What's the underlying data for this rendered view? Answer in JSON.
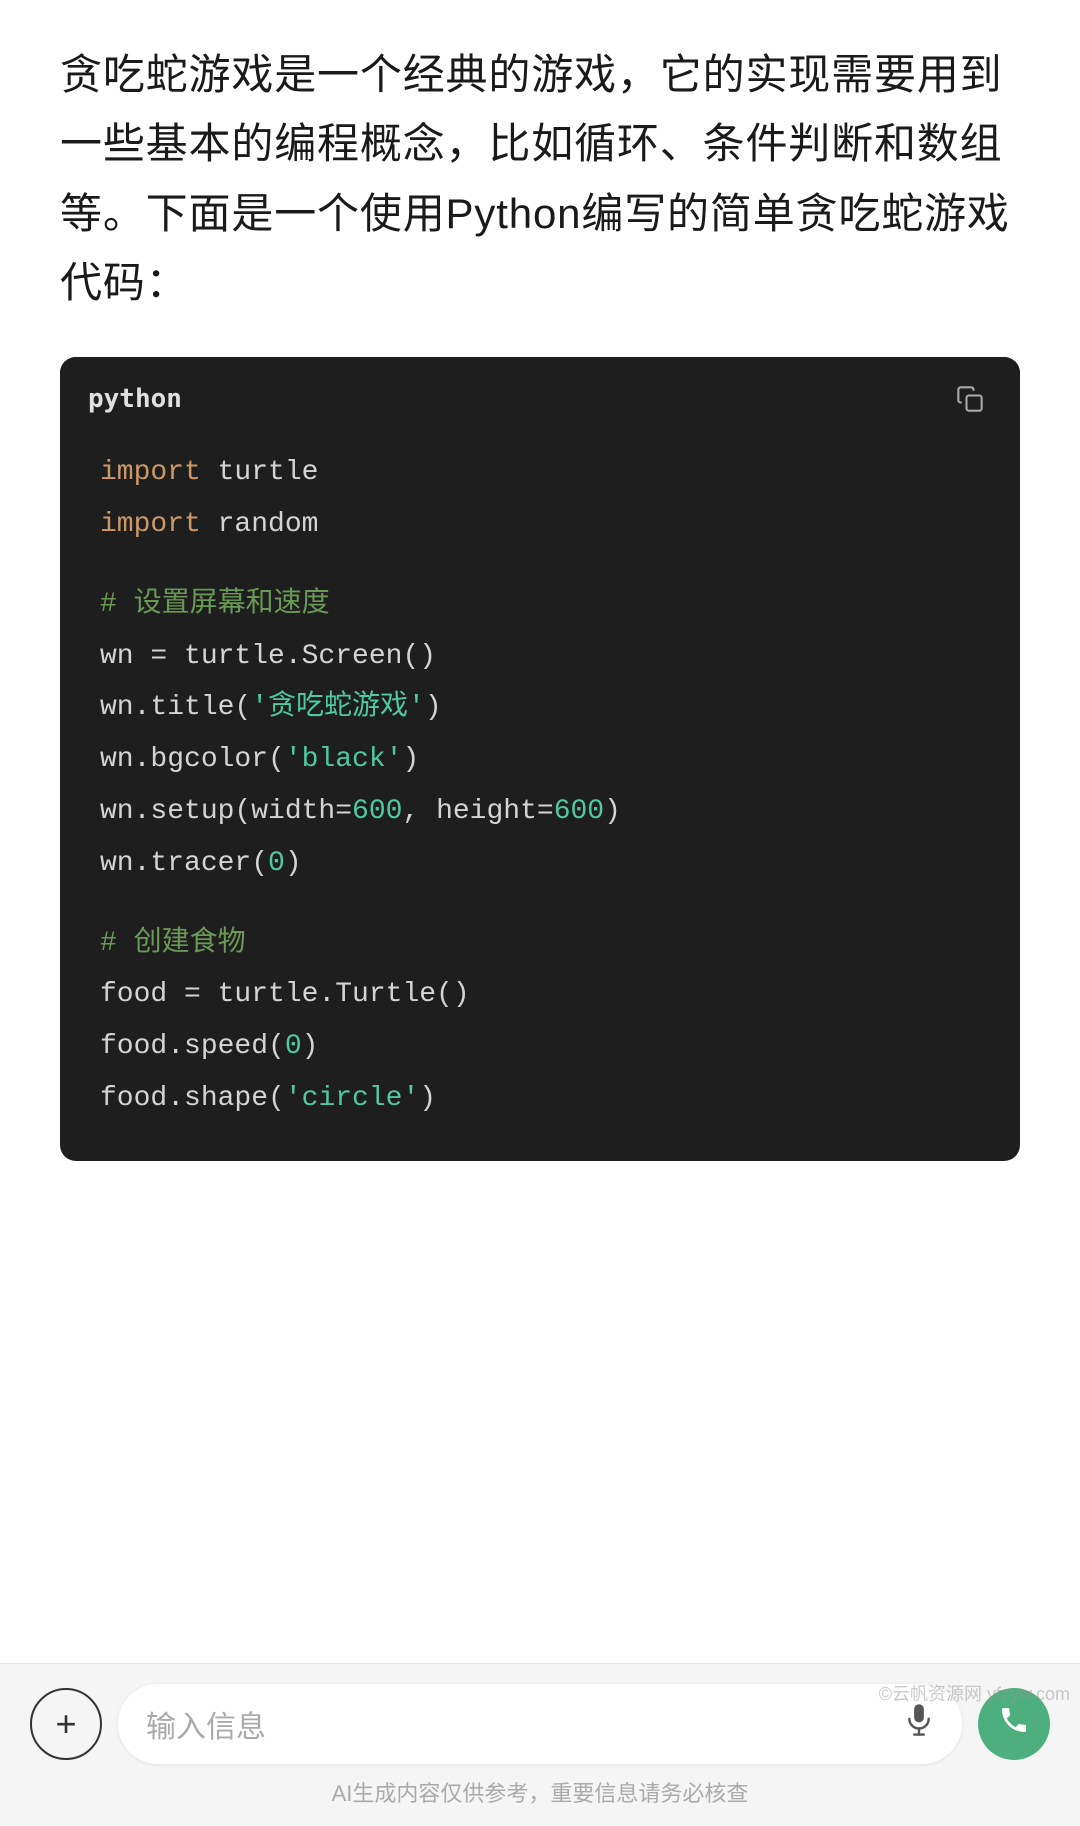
{
  "description": {
    "text": "贪吃蛇游戏是一个经典的游戏，它的实现需要用到一些基本的编程概念，比如循环、条件判断和数组等。下面是一个使用Python编写的简单贪吃蛇游戏代码："
  },
  "code_block": {
    "language": "python",
    "copy_label": "copy",
    "lines": [
      {
        "type": "import",
        "content": "import turtle"
      },
      {
        "type": "import",
        "content": "import random"
      },
      {
        "type": "empty"
      },
      {
        "type": "comment",
        "content": "# 设置屏幕和速度"
      },
      {
        "type": "plain",
        "content": "wn = turtle.Screen()"
      },
      {
        "type": "string_method",
        "method": "wn.title(",
        "string": "'贪吃蛇游戏'",
        "close": ")"
      },
      {
        "type": "string_method",
        "method": "wn.bgcolor(",
        "string": "'black'",
        "close": ")"
      },
      {
        "type": "param_method",
        "method": "wn.setup(width=",
        "num1": "600",
        "mid": ", height=",
        "num2": "600",
        "close": ")"
      },
      {
        "type": "num_method",
        "method": "wn.tracer(",
        "num": "0",
        "close": ")"
      },
      {
        "type": "empty"
      },
      {
        "type": "comment",
        "content": "# 创建食物"
      },
      {
        "type": "plain",
        "content": "food = turtle.Turtle()"
      },
      {
        "type": "num_method",
        "method": "food.speed(",
        "num": "0",
        "close": ")"
      },
      {
        "type": "string_method",
        "method": "food.shape(",
        "string": "'circle'",
        "close": ")"
      }
    ]
  },
  "bottom_bar": {
    "input_placeholder": "输入信息",
    "disclaimer": "AI生成内容仅供参考，重要信息请务必核查"
  },
  "watermark": "©云帆资源网 yfzyw.com"
}
